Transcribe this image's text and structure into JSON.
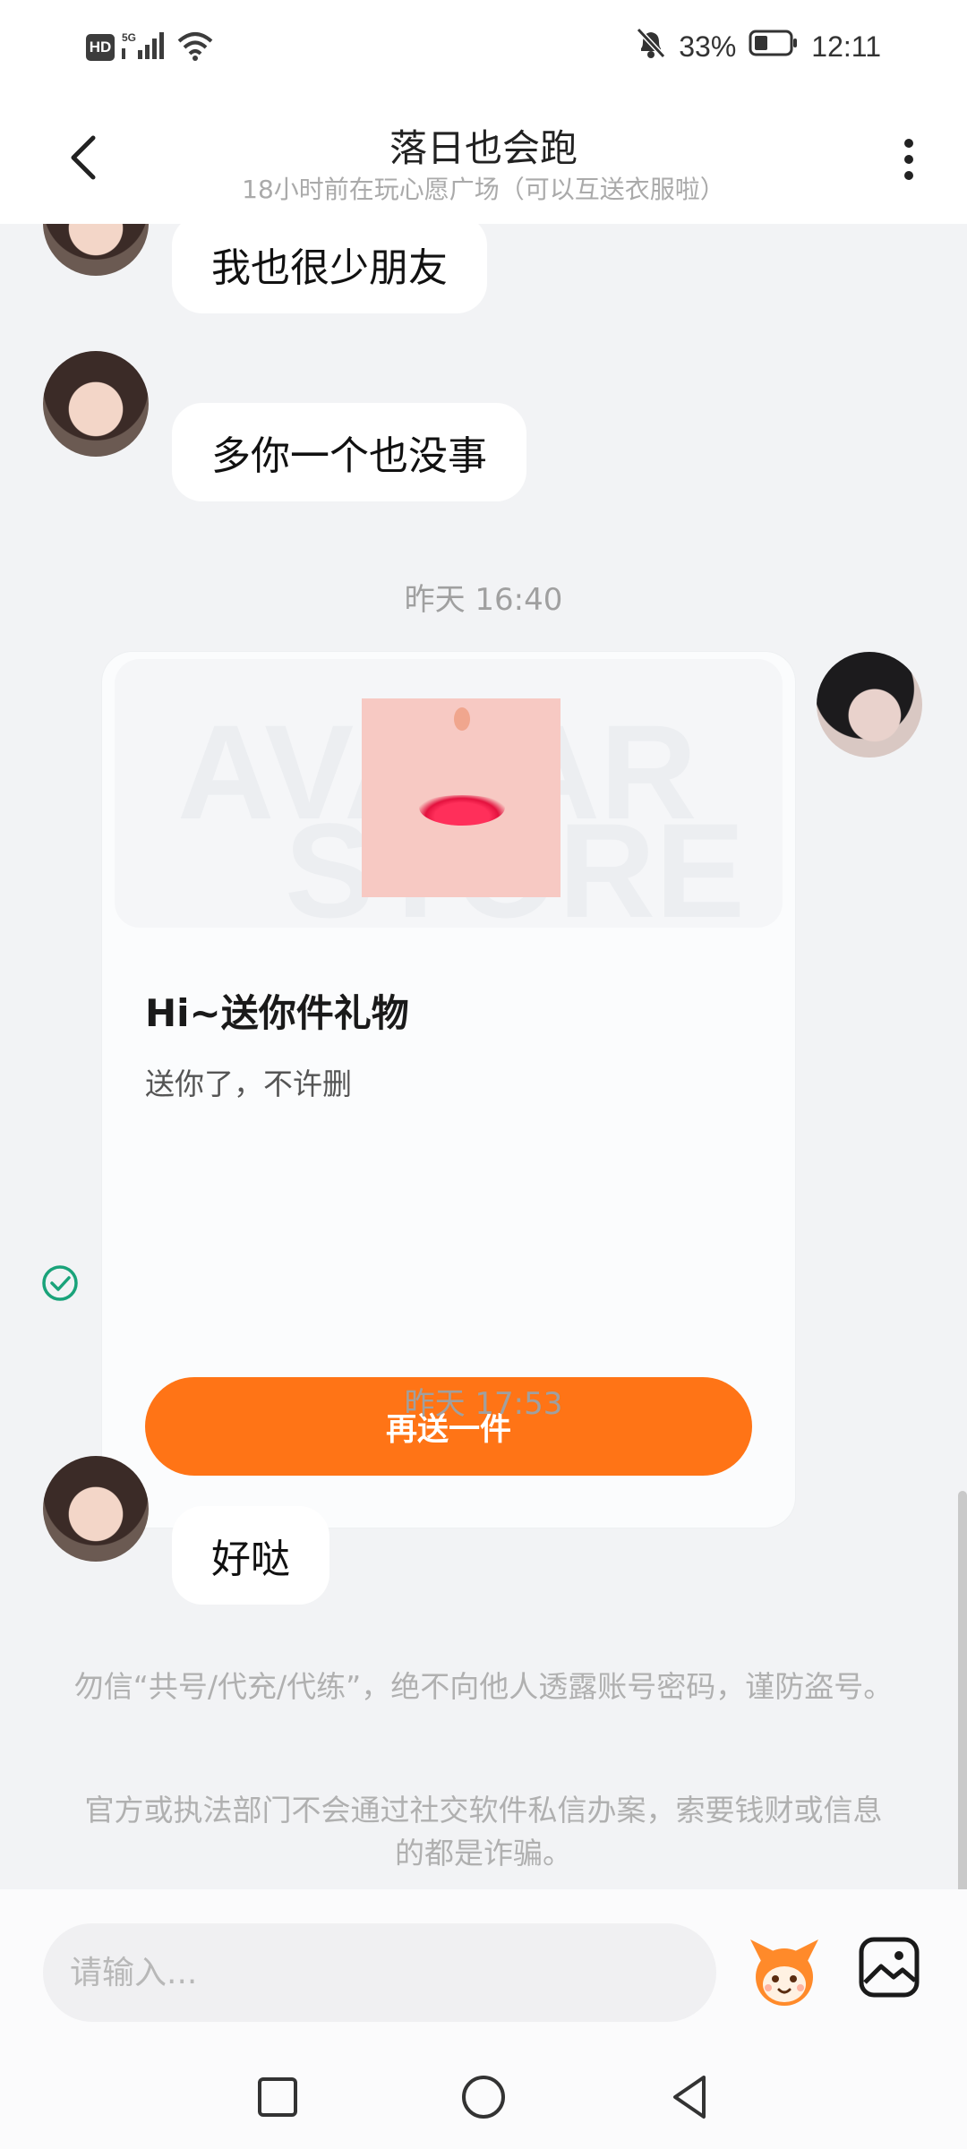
{
  "status_bar": {
    "hd": "HD",
    "net": "5G",
    "battery": "33%",
    "time": "12:11"
  },
  "header": {
    "title": "落日也会跑",
    "subtitle": "18小时前在玩心愿广场（可以互送衣服啦）"
  },
  "messages": [
    {
      "sender": "other",
      "text": "我也很少朋友"
    },
    {
      "sender": "other",
      "text": "多你一个也没事"
    }
  ],
  "time_labels": [
    "昨天 16:40",
    "昨天 17:53"
  ],
  "gift_card": {
    "title": "Hi~送你件礼物",
    "description": "送你了，不许删",
    "button_label": "再送一件",
    "watermark": "AVATAR STORE"
  },
  "last_message": {
    "sender": "other",
    "text": "好哒"
  },
  "notices": [
    "勿信“共号/代充/代练”，绝不向他人透露账号密码，谨防盗号。",
    "官方或执法部门不会通过社交软件私信办案，索要钱财或信息的都是诈骗。"
  ],
  "input": {
    "placeholder": "请输入..."
  },
  "colors": {
    "accent": "#ff7416",
    "background": "#f2f3f5",
    "check": "#1aa37a"
  }
}
